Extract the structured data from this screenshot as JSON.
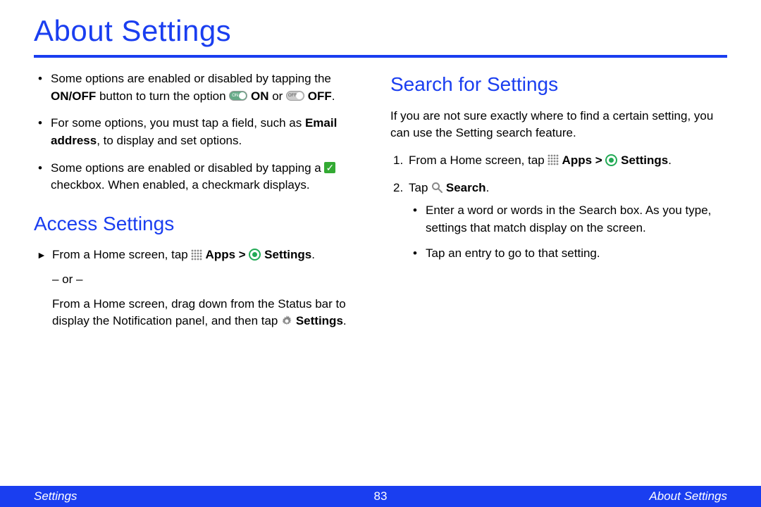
{
  "title": "About Settings",
  "left": {
    "bullets": [
      {
        "pre": "Some options are enabled or disabled by tapping the ",
        "bold1": "ON/OFF",
        "mid1": " button to turn the option ",
        "on_label": " ON",
        "mid2": " or ",
        "off_label": " OFF",
        "post": "."
      },
      {
        "pre": "For some options, you must tap a field, such as ",
        "bold1": "Email address",
        "post": ", to display and set options."
      },
      {
        "pre": "Some options are enabled or disabled by tapping a ",
        "post": " checkbox. When enabled, a checkmark displays."
      }
    ],
    "access_heading": "Access Settings",
    "access": {
      "step1_pre": "From a Home screen, tap ",
      "apps_label": " Apps > ",
      "settings_label": " Settings",
      "step1_post": ".",
      "or": "– or –",
      "alt_pre": "From a Home screen, drag down from the Status bar to display the Notification panel, and then tap ",
      "alt_settings": " Settings",
      "alt_post": "."
    }
  },
  "right": {
    "heading": "Search for Settings",
    "intro": "If you are not sure exactly where to find a certain setting, you can use the Setting search feature.",
    "steps": [
      {
        "pre": "From a Home screen, tap ",
        "apps_label": " Apps > ",
        "settings_label": " Settings",
        "post": "."
      },
      {
        "pre": "Tap ",
        "search_label": " Search",
        "post": ".",
        "sub": [
          "Enter a word or words in the Search box. As you type, settings that match display on the screen.",
          "Tap an entry to go to that setting."
        ]
      }
    ]
  },
  "footer": {
    "left": "Settings",
    "page": "83",
    "right": "About Settings"
  }
}
